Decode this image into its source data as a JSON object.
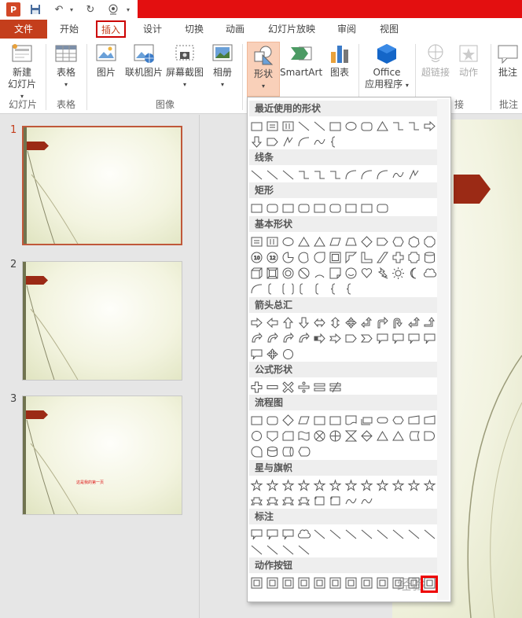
{
  "tabs": [
    "文件",
    "开始",
    "插入",
    "设计",
    "切换",
    "动画",
    "幻灯片放映",
    "审阅",
    "视图"
  ],
  "ribbon": {
    "new_slide": "新建\n幻灯片",
    "table": "表格",
    "picture": "图片",
    "online_picture": "联机图片",
    "screenshot": "屏幕截图",
    "album": "相册",
    "shapes": "形状",
    "smartart": "SmartArt",
    "chart": "图表",
    "office_apps": "Office\n应用程序",
    "hyperlink": "超链接",
    "action": "动作",
    "comment": "批注"
  },
  "groups": {
    "slides": "幻灯片",
    "tables": "表格",
    "images": "图像",
    "links": "接",
    "comments": "批注"
  },
  "dropdown": {
    "categories": [
      "最近使用的形状",
      "线条",
      "矩形",
      "基本形状",
      "箭头总汇",
      "公式形状",
      "流程图",
      "星与旗帜",
      "标注",
      "动作按钮"
    ]
  },
  "slides": {
    "numbers": [
      "1",
      "2",
      "3"
    ],
    "slide3_text": "这是我的第一页"
  },
  "watermark": "经验"
}
